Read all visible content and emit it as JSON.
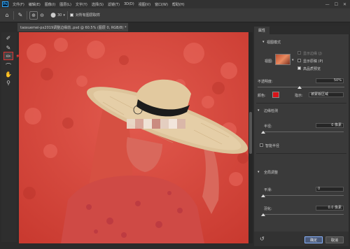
{
  "menubar": {
    "app_icon": "Ps",
    "items": [
      "文件(F)",
      "编辑(E)",
      "图像(I)",
      "图层(L)",
      "文字(Y)",
      "选择(S)",
      "滤镜(T)",
      "3D(D)",
      "视图(V)",
      "窗口(W)",
      "帮助(H)"
    ],
    "window_controls": [
      "—",
      "☐",
      "✕"
    ]
  },
  "options": {
    "brush_size": "30",
    "checkbox_label": "对所有图层取样"
  },
  "document": {
    "tab_title": "taoxuemei-px2019调整边缘前..psd @ 60.5% (图层 0, RGB/8) *",
    "close": "×"
  },
  "panel": {
    "title": "属性",
    "view_mode_section": "视图模式",
    "view_label": "视图:",
    "show_edge": "显示边缘 (J)",
    "show_original": "显示原稿 (P)",
    "high_quality": "高品质预览",
    "opacity_label": "不透明度:",
    "opacity_value": "50%",
    "color_label": "颜色:",
    "indicates_label": "指示:",
    "indicates_value": "被蒙版区域",
    "edge_detection": "边缘检测",
    "radius_label": "半径:",
    "radius_value": "0 像素",
    "smart_radius": "智能半径",
    "global_refine": "全局调整",
    "smooth_label": "平滑:",
    "smooth_value": "0",
    "feather_label": "羽化:",
    "feather_value": "0.0 像素",
    "ok": "确定",
    "cancel": "取消",
    "reset_icon": "↺"
  },
  "colors": {
    "overlay": "#e0463b",
    "swatch": "#d9141a"
  }
}
